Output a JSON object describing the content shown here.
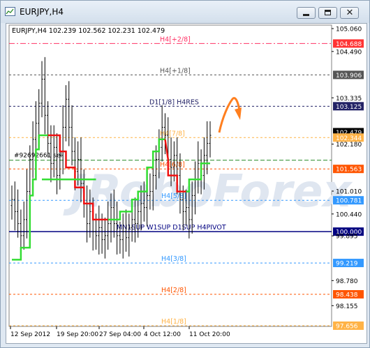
{
  "window": {
    "title": "EURJPY,H4",
    "buttons": [
      "minimize-icon",
      "restore-icon",
      "close-icon"
    ]
  },
  "chart": {
    "info_line": "EURJPY,H4  102.239 102.562 102.231 102.479",
    "watermark": "JRoboForex",
    "price_labels": [
      {
        "text": "105.060",
        "price": 105.06
      },
      {
        "text": "104.688",
        "price": 104.688,
        "highlight": "#ff3333"
      },
      {
        "text": "104.490",
        "price": 104.49
      },
      {
        "text": "103.906",
        "price": 103.906,
        "highlight": "#555555"
      },
      {
        "text": "103.335",
        "price": 103.335
      },
      {
        "text": "103.125",
        "price": 103.125,
        "highlight": "#222266"
      },
      {
        "text": "102.479",
        "price": 102.479,
        "highlight": "#000000"
      },
      {
        "text": "102.344",
        "price": 102.344,
        "highlight": "#ffb347"
      },
      {
        "text": "102.180",
        "price": 102.18
      },
      {
        "text": "101.563",
        "price": 101.563,
        "highlight": "#ff5500"
      },
      {
        "text": "101.010",
        "price": 101.01
      },
      {
        "text": "100.781",
        "price": 100.781,
        "highlight": "#3399ff"
      },
      {
        "text": "100.440",
        "price": 100.44
      },
      {
        "text": "100.000",
        "price": 100.0,
        "highlight": "#000080"
      },
      {
        "text": "99.895",
        "price": 99.895
      },
      {
        "text": "99.219",
        "price": 99.219,
        "highlight": "#3399ff"
      },
      {
        "text": "98.780",
        "price": 98.78
      },
      {
        "text": "98.438",
        "price": 98.438,
        "highlight": "#ff5500"
      },
      {
        "text": "98.155",
        "price": 98.155
      },
      {
        "text": "97.656",
        "price": 97.656,
        "highlight": "#ffb347"
      }
    ],
    "murray_levels": [
      {
        "label": "H4[+2/8]",
        "price": 104.688,
        "color": "#ff3366",
        "style": "dashdot"
      },
      {
        "label": "H4[+1/8]",
        "price": 103.906,
        "color": "#555555",
        "style": "dash"
      },
      {
        "label": "D1[1/8] H4RES",
        "price": 103.125,
        "color": "#222266",
        "style": "dash"
      },
      {
        "label": "H4[7/8]",
        "price": 102.344,
        "color": "#ffb347",
        "style": "dash"
      },
      {
        "label": "H4[6/8]",
        "price": 101.563,
        "color": "#ff5500",
        "style": "dash"
      },
      {
        "label": "H4[5/8]",
        "price": 100.781,
        "color": "#3399ff",
        "style": "dash"
      },
      {
        "label": "MN1SUP W1SUP D1SUP H4PIVOT",
        "price": 100.0,
        "color": "#000080",
        "style": "solid"
      },
      {
        "label": "H4[3/8]",
        "price": 99.219,
        "color": "#3399ff",
        "style": "dash"
      },
      {
        "label": "H4[2/8]",
        "price": 98.438,
        "color": "#ff5500",
        "style": "dash"
      },
      {
        "label": "H4[1/8]",
        "price": 97.656,
        "color": "#ffb347",
        "style": "dash"
      }
    ],
    "order_line": {
      "label": "#92692661 sell",
      "price": 101.78,
      "color": "#228822"
    },
    "date_labels": [
      "12 Sep 2012",
      "19 Sep 20:00",
      "27 Sep 04:00",
      "4 Oct 12:00",
      "11 Oct 20:00"
    ],
    "colors": {
      "candles": "#000000",
      "trend_up": "#33dd33",
      "trend_down": "#ee1111",
      "forecast_arrow": "#ff7f1f"
    },
    "candle_closes": [
      100.8,
      100.5,
      100.2,
      99.9,
      100.3,
      101.0,
      101.8,
      102.3,
      102.7,
      103.2,
      103.8,
      102.9,
      102.2,
      101.7,
      102.1,
      101.4,
      101.9,
      102.6,
      103.3,
      102.6,
      102.0,
      101.5,
      101.8,
      101.2,
      100.7,
      100.2,
      100.5,
      100.0,
      99.9,
      100.1,
      99.8,
      99.9,
      100.2,
      100.6,
      100.2,
      99.9,
      99.8,
      100.0,
      99.85,
      100.1,
      100.3,
      100.2,
      100.5,
      100.7,
      100.6,
      100.9,
      101.0,
      101.4,
      101.8,
      102.1,
      102.6,
      102.4,
      101.8,
      101.6,
      101.9,
      101.4,
      100.8,
      100.5,
      100.6,
      100.3,
      100.9,
      101.3,
      101.7,
      101.4,
      101.9,
      102.2,
      102.4
    ]
  }
}
